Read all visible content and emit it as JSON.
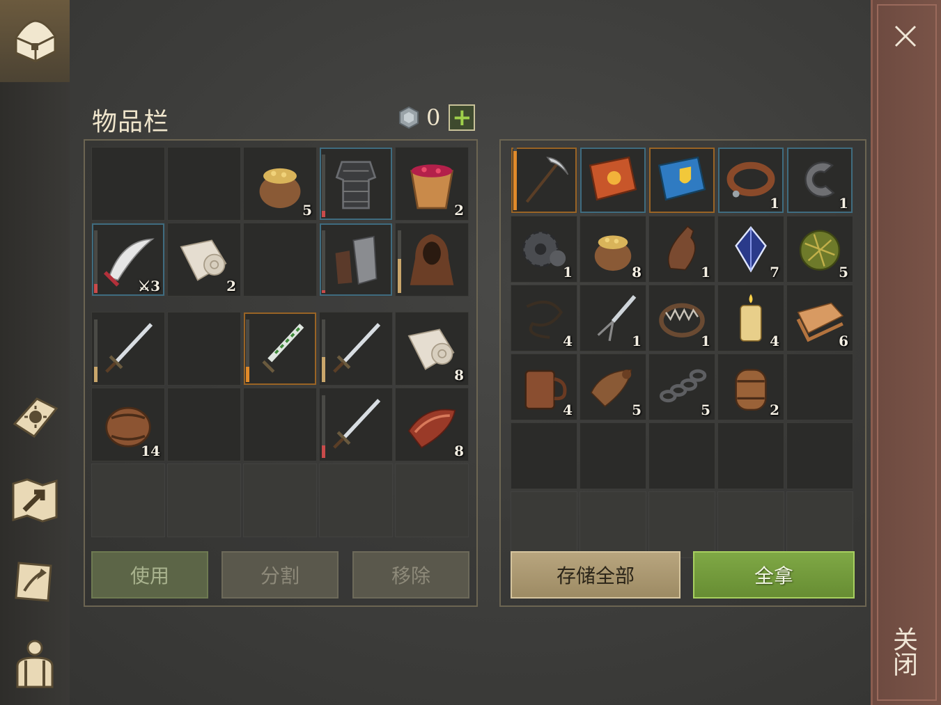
{
  "inventory": {
    "title": "物品栏",
    "currency_count": "0",
    "add_label": "+"
  },
  "player_slots": [
    {
      "item": null
    },
    {
      "item": null
    },
    {
      "item": "grain-sack-icon",
      "qty": "5"
    },
    {
      "item": "chainmail-armor-icon",
      "qty": "",
      "frame": "blue",
      "durability": 0.1,
      "durability_color": "#c94b4b"
    },
    {
      "item": "berry-bucket-icon",
      "qty": "2"
    },
    {
      "item": "scimitar-icon",
      "qty": "⚔3",
      "frame": "blue",
      "durability": 0.15,
      "durability_color": "#c94b4b"
    },
    {
      "item": "cloth-roll-icon",
      "qty": "2"
    },
    {
      "item": null
    },
    {
      "item": "armored-gloves-icon",
      "qty": "",
      "frame": "blue",
      "durability": 0.05,
      "durability_color": "#c94b4b"
    },
    {
      "item": "hooded-cloak-icon",
      "qty": "",
      "durability": 0.55,
      "durability_color": "#c9a66b"
    }
  ],
  "backpack_slots": [
    {
      "item": "longsword-icon",
      "qty": "",
      "durability": 0.25,
      "durability_color": "#c9a66b"
    },
    {
      "item": null
    },
    {
      "item": "poisoned-dagger-icon",
      "qty": "",
      "frame": "orange",
      "durability": 0.25,
      "durability_color": "#e08a2a"
    },
    {
      "item": "longsword-icon",
      "qty": "",
      "durability": 0.4,
      "durability_color": "#c9a66b"
    },
    {
      "item": "cloth-roll-icon",
      "qty": "8"
    },
    {
      "item": "barrel-icon",
      "qty": "14"
    },
    {
      "item": null
    },
    {
      "item": null
    },
    {
      "item": "longsword-icon",
      "qty": "",
      "durability": 0.2,
      "durability_color": "#c94b4b"
    },
    {
      "item": "raw-meat-icon",
      "qty": "8"
    }
  ],
  "container_slots": [
    {
      "item": "pickaxe-icon",
      "qty": "",
      "frame": "orange",
      "durability": 0.95,
      "durability_color": "#e08a2a"
    },
    {
      "item": "sun-recipe-book-icon",
      "qty": "",
      "frame": "blue"
    },
    {
      "item": "blue-recipe-book-icon",
      "qty": "",
      "frame": "orange"
    },
    {
      "item": "leather-collar-icon",
      "qty": "1",
      "frame": "blue"
    },
    {
      "item": "iron-clamp-icon",
      "qty": "1",
      "frame": "blue"
    },
    {
      "item": "gear-part-icon",
      "qty": "1"
    },
    {
      "item": "grain-sack-icon",
      "qty": "8"
    },
    {
      "item": "leather-flask-icon",
      "qty": "1"
    },
    {
      "item": "mana-crystal-icon",
      "qty": "7"
    },
    {
      "item": "hay-ball-icon",
      "qty": "5"
    },
    {
      "item": "rope-coil-icon",
      "qty": "4"
    },
    {
      "item": "fork-blade-icon",
      "qty": "1"
    },
    {
      "item": "bear-trap-icon",
      "qty": "1"
    },
    {
      "item": "candle-icon",
      "qty": "4"
    },
    {
      "item": "fabric-bolt-icon",
      "qty": "6"
    },
    {
      "item": "wooden-mug-icon",
      "qty": "4"
    },
    {
      "item": "leather-scrap-icon",
      "qty": "5"
    },
    {
      "item": "iron-chain-icon",
      "qty": "5"
    },
    {
      "item": "small-barrel-icon",
      "qty": "2"
    },
    {
      "item": null
    },
    {
      "item": null
    },
    {
      "item": null
    },
    {
      "item": null
    },
    {
      "item": null
    },
    {
      "item": null
    }
  ],
  "buttons": {
    "use": "使用",
    "split": "分割",
    "remove": "移除",
    "store_all": "存储全部",
    "take_all": "全拿"
  },
  "close_label": "关闭",
  "sidebar": [
    "chest-icon",
    "sun-book-icon",
    "map-icon",
    "quest-scroll-icon",
    "character-icon"
  ]
}
